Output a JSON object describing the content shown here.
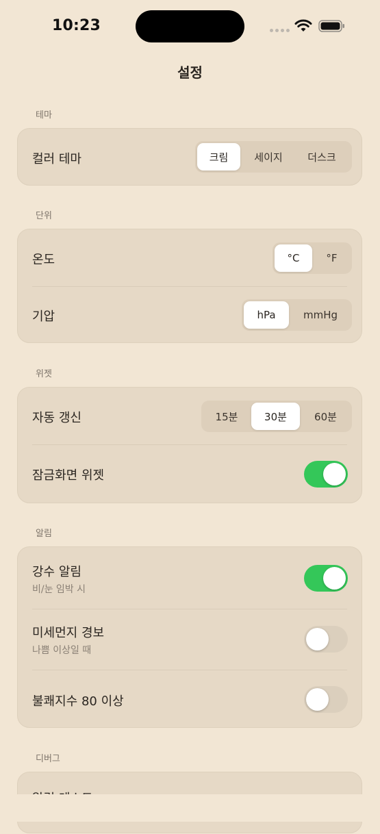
{
  "status": {
    "time": "10:23",
    "icons": [
      "cellular-signal-icon",
      "wifi-icon",
      "battery-icon"
    ]
  },
  "nav": {
    "title": "설정"
  },
  "sections": {
    "theme": {
      "label": "테마",
      "color_theme": {
        "label": "컬러 테마",
        "options": [
          "크림",
          "세이지",
          "더스크"
        ],
        "selected": "크림"
      }
    },
    "units": {
      "label": "단위",
      "temperature": {
        "label": "온도",
        "options": [
          "°C",
          "°F"
        ],
        "selected": "°C"
      },
      "pressure": {
        "label": "기압",
        "options": [
          "hPa",
          "mmHg"
        ],
        "selected": "hPa"
      }
    },
    "widget": {
      "label": "위젯",
      "auto_refresh": {
        "label": "자동 갱신",
        "options": [
          "15분",
          "30분",
          "60분"
        ],
        "selected": "30분"
      },
      "lock_screen": {
        "label": "잠금화면 위젯",
        "on": true
      }
    },
    "alerts": {
      "label": "알림",
      "rain": {
        "label": "강수 알림",
        "sub": "비/눈 임박 시",
        "on": true
      },
      "dust": {
        "label": "미세먼지 경보",
        "sub": "나쁨 이상일 때",
        "on": false
      },
      "discomfort": {
        "label": "불쾌지수 80 이상",
        "on": false
      }
    },
    "debug": {
      "label": "디버그",
      "test_alert": {
        "label": "알림 테스트"
      }
    }
  },
  "colors": {
    "background": "#F2E6D4",
    "card": "#E6D9C6",
    "toggle_on": "#34C759",
    "toggle_off": "#DBCFBD"
  }
}
